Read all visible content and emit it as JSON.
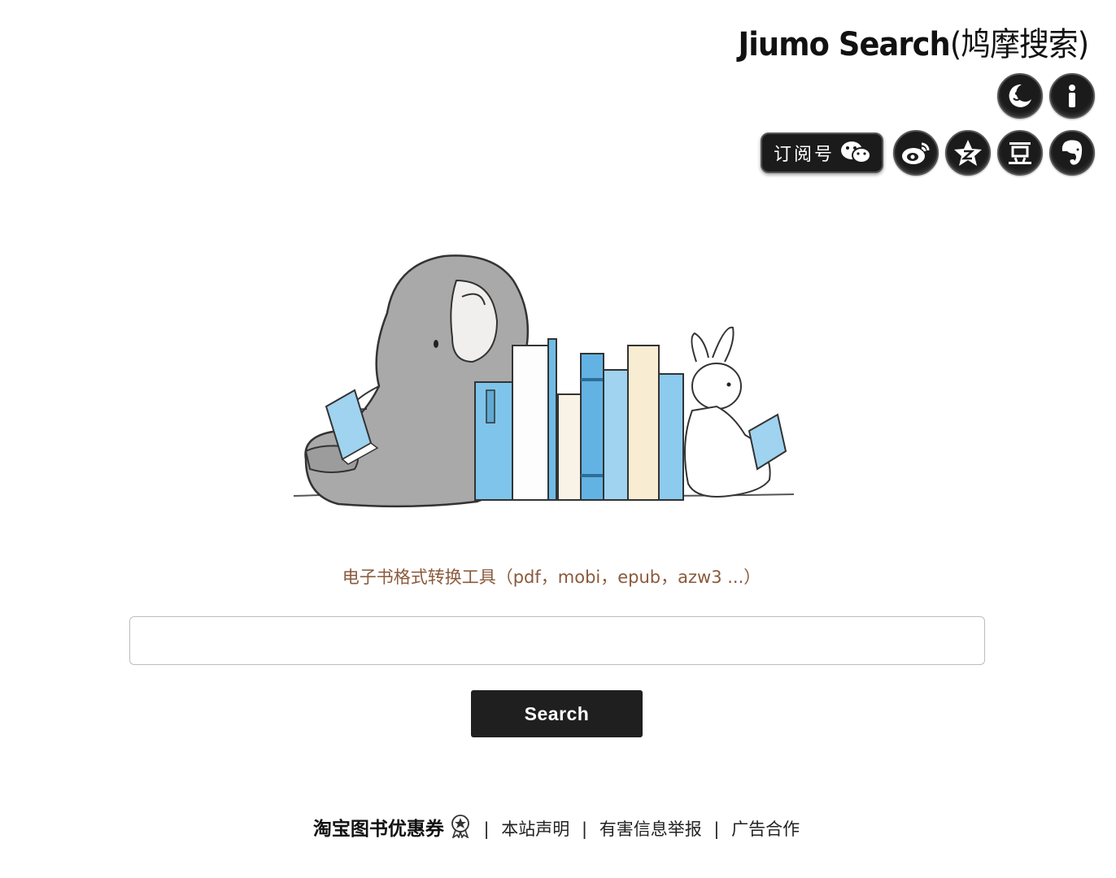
{
  "header": {
    "logo_text": "Jiumo Search",
    "logo_cn": "(鸠摩搜索)"
  },
  "icons_row1": [
    {
      "name": "night-mode-icon"
    },
    {
      "name": "info-icon"
    }
  ],
  "icons_row2": {
    "subscribe_label": "订阅号",
    "social": [
      {
        "name": "weibo-icon"
      },
      {
        "name": "qzone-icon"
      },
      {
        "name": "douban-icon",
        "glyph": "豆"
      },
      {
        "name": "evernote-icon"
      }
    ]
  },
  "main": {
    "subtitle": "电子书格式转换工具（pdf，mobi，epub，azw3 ...）",
    "search_value": "",
    "search_placeholder": "",
    "search_button": "Search"
  },
  "footer": {
    "coupon_link": "淘宝图书优惠券",
    "links": [
      "本站声明",
      "有害信息举报",
      "广告合作"
    ],
    "separator": "|"
  },
  "colors": {
    "subtitle": "#8a5a3c",
    "button_bg": "#1f1f1f",
    "icon_bg": "#1b1b1b"
  }
}
